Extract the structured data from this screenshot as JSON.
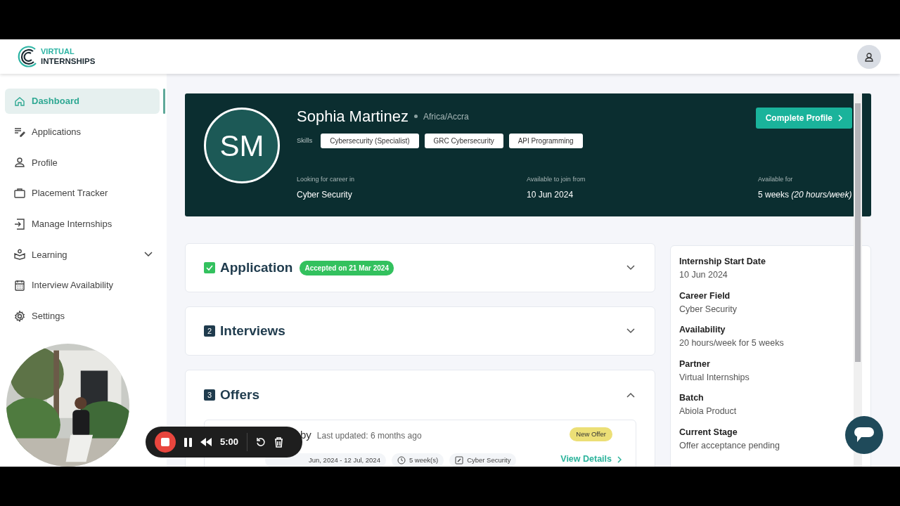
{
  "brand": {
    "line1": "VIRTUAL",
    "line2": "INTERNSHIPS"
  },
  "sidebar": {
    "items": [
      {
        "label": "Dashboard",
        "kind": "link",
        "selected": true
      },
      {
        "label": "Applications",
        "kind": "link",
        "selected": false
      },
      {
        "label": "Profile",
        "kind": "link",
        "selected": false
      },
      {
        "label": "Placement Tracker",
        "kind": "link",
        "selected": false
      },
      {
        "label": "Manage Internships",
        "kind": "link",
        "selected": false
      },
      {
        "label": "Learning",
        "kind": "group",
        "selected": false
      },
      {
        "label": "Interview Availability",
        "kind": "link",
        "selected": false
      },
      {
        "label": "Settings",
        "kind": "link",
        "selected": false
      }
    ]
  },
  "profile": {
    "initials": "SM",
    "name": "Sophia Martinez",
    "timezone": "Africa/Accra",
    "skills_label": "Skills",
    "skills": [
      "Cybersecurity (Specialist)",
      "GRC Cybersecurity",
      "API Programming"
    ],
    "action": "Complete Profile",
    "facts": [
      {
        "label": "Looking for career in",
        "value": "Cyber Security"
      },
      {
        "label": "Available to join from",
        "value": "10 Jun 2024"
      },
      {
        "label": "Available for",
        "value": "5 weeks *(20 hours/week)*"
      }
    ]
  },
  "sections": [
    {
      "kind": "check",
      "title": "Application",
      "badge": "Accepted on 21 Mar 2024",
      "expanded": false
    },
    {
      "kind": "number",
      "marker": "2",
      "title": "Interviews",
      "expanded": false
    },
    {
      "kind": "number",
      "marker": "3",
      "title": "Offers",
      "expanded": true
    }
  ],
  "offer": {
    "title": "by",
    "updated": "Last updated: 6 months ago",
    "status": "New Offer",
    "chips": [
      {
        "kind": "dates",
        "text": "Jun, 2024 - 12 Jul, 2024"
      },
      {
        "kind": "clock",
        "text": "5 week(s)"
      },
      {
        "kind": "field",
        "text": "Cyber Security"
      }
    ],
    "action": "View Details"
  },
  "summary": [
    {
      "label": "Internship Start Date",
      "value": "10 Jun 2024"
    },
    {
      "label": "Career Field",
      "value": "Cyber Security"
    },
    {
      "label": "Availability",
      "value": "20 hours/week for 5 weeks"
    },
    {
      "label": "Partner",
      "value": "Virtual Internships"
    },
    {
      "label": "Batch",
      "value": "Abiola Product"
    },
    {
      "label": "Current Stage",
      "value": "Offer acceptance pending"
    }
  ],
  "recorder": {
    "time": "5:00"
  }
}
